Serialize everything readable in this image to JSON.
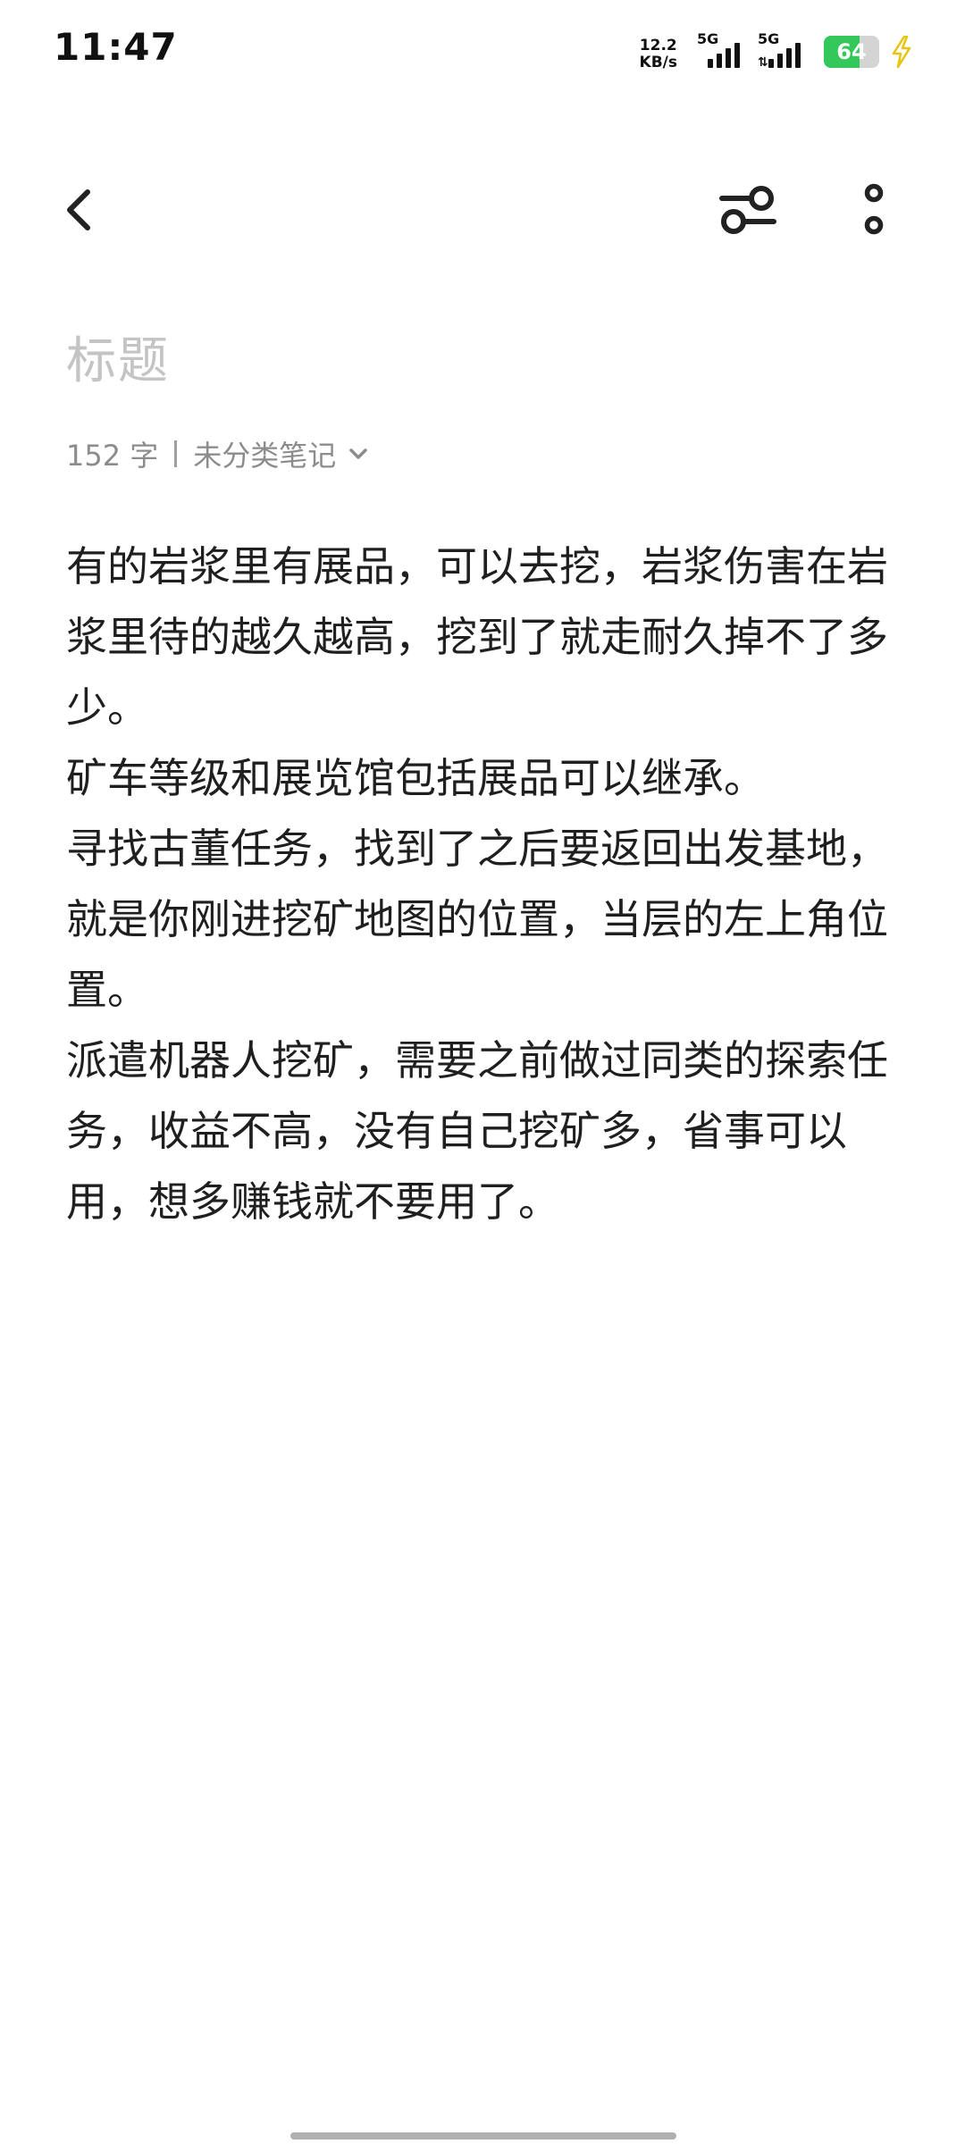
{
  "status_bar": {
    "time": "11:47",
    "net_speed_value": "12.2",
    "net_speed_unit": "KB/s",
    "sim1_network": "5G",
    "sim2_network": "5G",
    "battery_level": "64",
    "battery_fraction": 0.64,
    "charging": true,
    "battery_color": "#34c759"
  },
  "toolbar": {
    "back_icon": "chevron-left-icon",
    "format_icon": "sliders-icon",
    "more_icon": "vertical-dots-icon"
  },
  "note": {
    "title_placeholder": "标题",
    "word_count": "152 字",
    "category": "未分类笔记",
    "category_icon": "chevron-down-icon",
    "paragraphs": [
      "有的岩浆里有展品，可以去挖，岩浆伤害在岩浆里待的越久越高，挖到了就走耐久掉不了多少。",
      "矿车等级和展览馆包括展品可以继承。",
      "寻找古董任务，找到了之后要返回出发基地，就是你刚进挖矿地图的位置，当层的左上角位置。",
      "派遣机器人挖矿，需要之前做过同类的探索任务，收益不高，没有自己挖矿多，省事可以用，想多赚钱就不要用了。"
    ]
  }
}
